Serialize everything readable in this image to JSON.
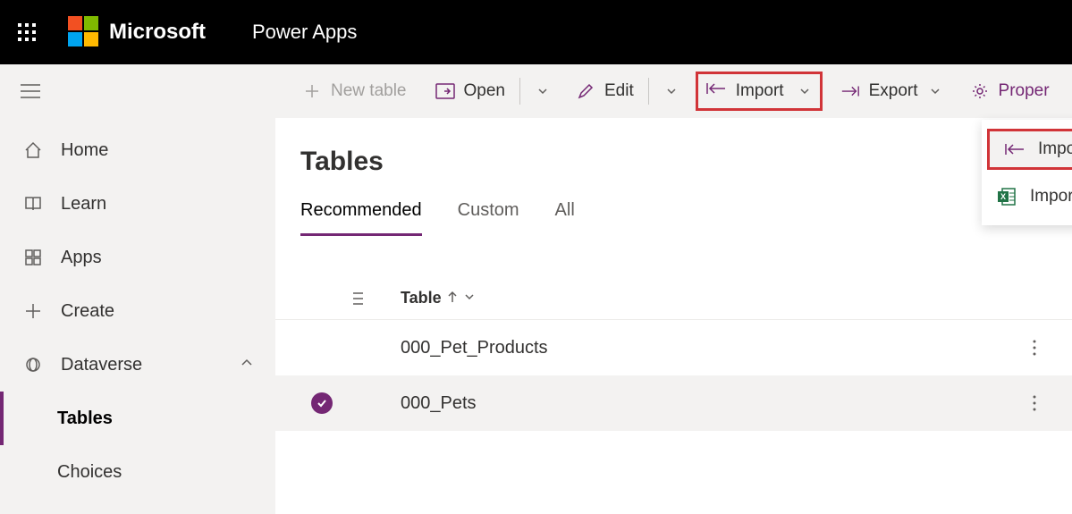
{
  "header": {
    "brand": "Microsoft",
    "app": "Power Apps"
  },
  "sidebar": {
    "items": [
      {
        "label": "Home"
      },
      {
        "label": "Learn"
      },
      {
        "label": "Apps"
      },
      {
        "label": "Create"
      },
      {
        "label": "Dataverse"
      }
    ],
    "sub": [
      {
        "label": "Tables"
      },
      {
        "label": "Choices"
      }
    ]
  },
  "toolbar": {
    "new_table": "New table",
    "open": "Open",
    "edit": "Edit",
    "import": "Import",
    "export": "Export",
    "properties": "Proper"
  },
  "import_menu": {
    "item1": "Import data",
    "item2": "Import data from Excel"
  },
  "page": {
    "title": "Tables",
    "tabs": [
      "Recommended",
      "Custom",
      "All"
    ],
    "column": "Table",
    "rows": [
      "000_Pet_Products",
      "000_Pets"
    ]
  }
}
